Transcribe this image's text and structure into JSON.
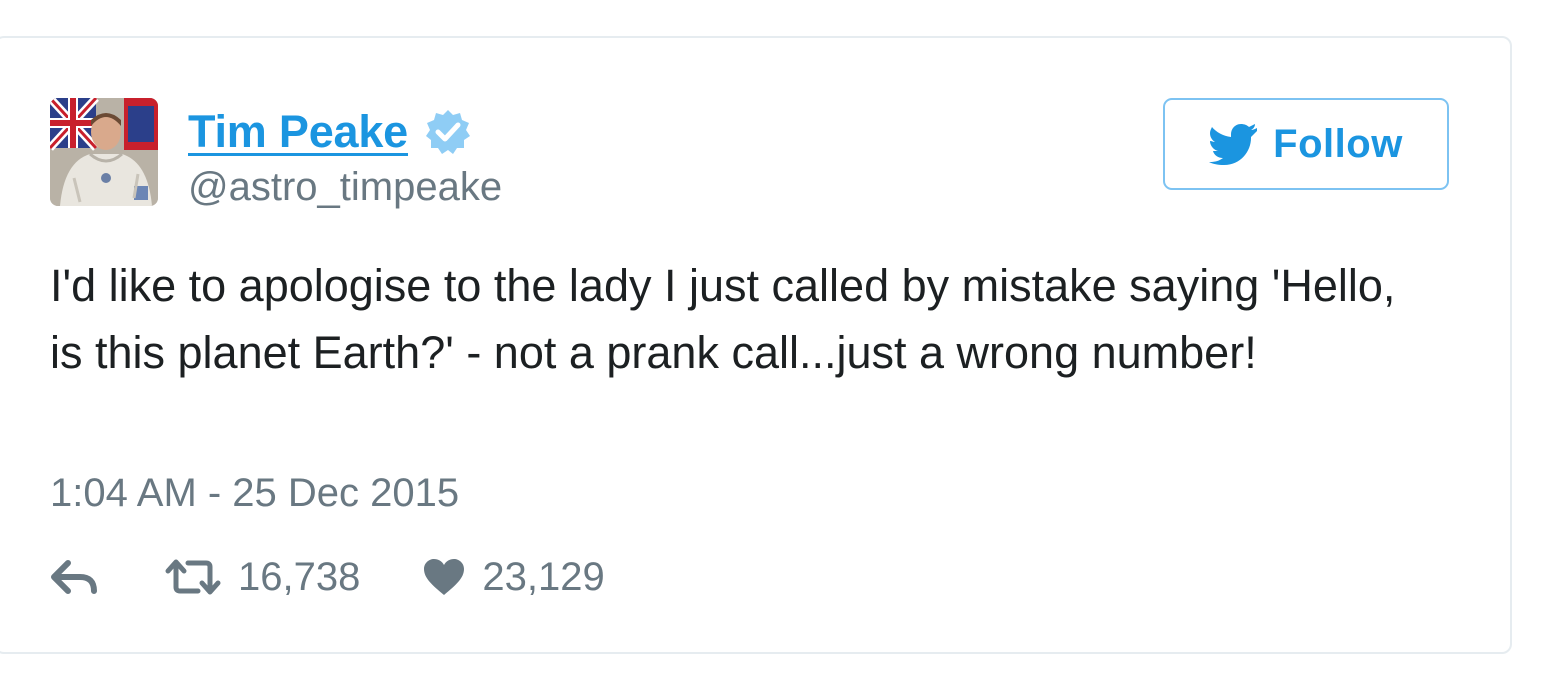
{
  "author": {
    "name": "Tim Peake",
    "handle": "@astro_timpeake",
    "verified": true,
    "avatar_icon": "astronaut-avatar"
  },
  "follow_button": {
    "label": "Follow",
    "icon": "twitter-bird-icon"
  },
  "tweet": {
    "text": "I'd like to apologise to the lady I just called by mistake saying 'Hello, is this planet Earth?' - not a prank call...just a wrong number!",
    "timestamp": "1:04 AM - 25 Dec 2015"
  },
  "actions": {
    "reply_icon": "reply-icon",
    "retweet_icon": "retweet-icon",
    "retweets": "16,738",
    "like_icon": "heart-icon",
    "likes": "23,129"
  },
  "colors": {
    "link_blue": "#1b95e0",
    "verified_blue": "#8fcdf5",
    "muted_text": "#697882",
    "body_text": "#1c2022",
    "card_border": "#e6ecf0"
  }
}
